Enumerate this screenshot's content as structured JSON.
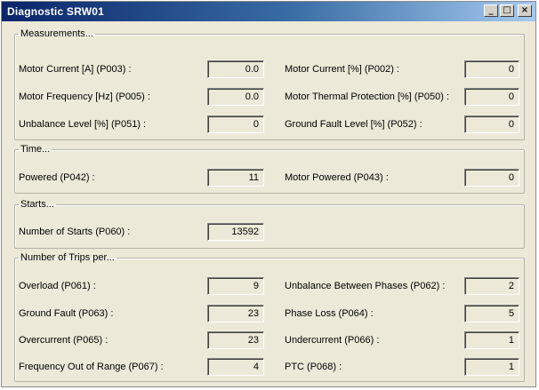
{
  "window": {
    "title": "Diagnostic SRW01",
    "controls": {
      "minimize": "_",
      "maximize": "□",
      "close": "×"
    }
  },
  "groups": {
    "measurements": {
      "title": "Measurements...",
      "fields": [
        {
          "label": "Motor Current [A] (P003) :",
          "value": "0.0"
        },
        {
          "label": "Motor Current [%] (P002) :",
          "value": "0"
        },
        {
          "label": "Motor Frequency [Hz] (P005) :",
          "value": "0.0"
        },
        {
          "label": "Motor Thermal Protection [%] (P050) :",
          "value": "0"
        },
        {
          "label": "Unbalance Level [%] (P051) :",
          "value": "0"
        },
        {
          "label": "Ground Fault Level [%] (P052) :",
          "value": "0"
        }
      ]
    },
    "time": {
      "title": "Time...",
      "fields": [
        {
          "label": "Powered (P042) :",
          "value": "11"
        },
        {
          "label": "Motor Powered (P043) :",
          "value": "0"
        }
      ]
    },
    "starts": {
      "title": "Starts...",
      "fields": [
        {
          "label": "Number of Starts (P060) :",
          "value": "13592"
        }
      ]
    },
    "trips": {
      "title": "Number of Trips per...",
      "fields": [
        {
          "label": "Overload (P061) :",
          "value": "9"
        },
        {
          "label": "Unbalance Between Phases (P062) :",
          "value": "2"
        },
        {
          "label": "Ground Fault (P063) :",
          "value": "23"
        },
        {
          "label": "Phase Loss (P064) :",
          "value": "5"
        },
        {
          "label": "Overcurrent (P065) :",
          "value": "23"
        },
        {
          "label": "Undercurrent (P066) :",
          "value": "1"
        },
        {
          "label": "Frequency Out of Range (P067) :",
          "value": "4"
        },
        {
          "label": "PTC (P068) :",
          "value": "1"
        }
      ]
    }
  }
}
